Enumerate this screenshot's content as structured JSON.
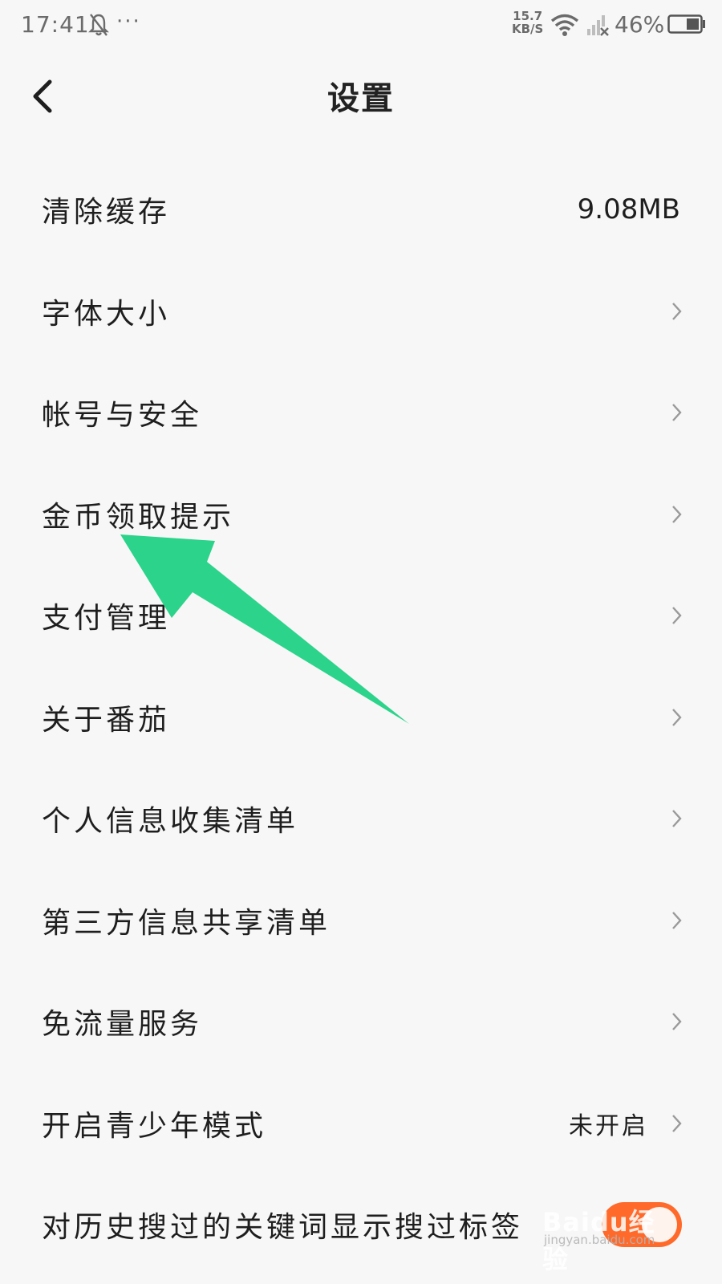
{
  "status_bar": {
    "time": "17:41",
    "more": "···",
    "speed_value": "15.7",
    "speed_unit": "KB/S",
    "battery_percent": "46%"
  },
  "header": {
    "title": "设置",
    "back_icon": "chevron-left-icon"
  },
  "settings": {
    "items": [
      {
        "label": "清除缓存",
        "value": "9.08MB"
      },
      {
        "label": "字体大小",
        "icon": "chevron-right-icon"
      },
      {
        "label": "帐号与安全",
        "icon": "chevron-right-icon"
      },
      {
        "label": "金币领取提示",
        "icon": "chevron-right-icon"
      },
      {
        "label": "支付管理",
        "icon": "chevron-right-icon"
      },
      {
        "label": "关于番茄",
        "icon": "chevron-right-icon"
      },
      {
        "label": "个人信息收集清单",
        "icon": "chevron-right-icon"
      },
      {
        "label": "第三方信息共享清单",
        "icon": "chevron-right-icon"
      },
      {
        "label": "免流量服务",
        "icon": "chevron-right-icon"
      },
      {
        "label": "开启青少年模式",
        "value": "未开启",
        "icon": "chevron-right-icon"
      },
      {
        "label": "对历史搜过的关键词显示搜过标签",
        "toggle": true
      }
    ]
  },
  "watermark": {
    "text": "Baidu经验",
    "url": "jingyan.baidu.com"
  },
  "colors": {
    "background": "#f7f7f7",
    "arrow": "#2bd48a",
    "toggle_on": "#ff6a2b",
    "text": "#1e1e1e",
    "chevron": "#9a9a9a"
  }
}
